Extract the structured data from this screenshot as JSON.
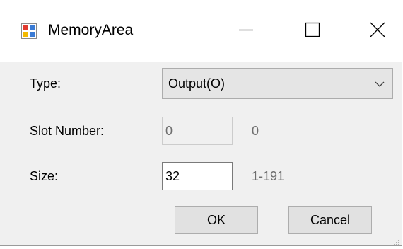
{
  "window": {
    "title": "MemoryArea",
    "icon": "app-window-icon",
    "controls": {
      "minimize_icon": "minimize-icon",
      "maximize_icon": "maximize-icon",
      "close_icon": "close-icon"
    }
  },
  "form": {
    "type": {
      "label": "Type:",
      "selected": "Output(O)",
      "arrow_icon": "chevron-down-icon"
    },
    "slot_number": {
      "label": "Slot Number:",
      "value": "0",
      "enabled": false,
      "hint": "0"
    },
    "size": {
      "label": "Size:",
      "value": "32",
      "hint": "1-191"
    }
  },
  "buttons": {
    "ok_label": "OK",
    "cancel_label": "Cancel"
  },
  "colors": {
    "titlebar": "#ffffff",
    "client": "#f0f0f0",
    "hint_text": "#6d6d6d",
    "button_face": "#e1e1e1",
    "combo_face": "#e5e5e5"
  }
}
